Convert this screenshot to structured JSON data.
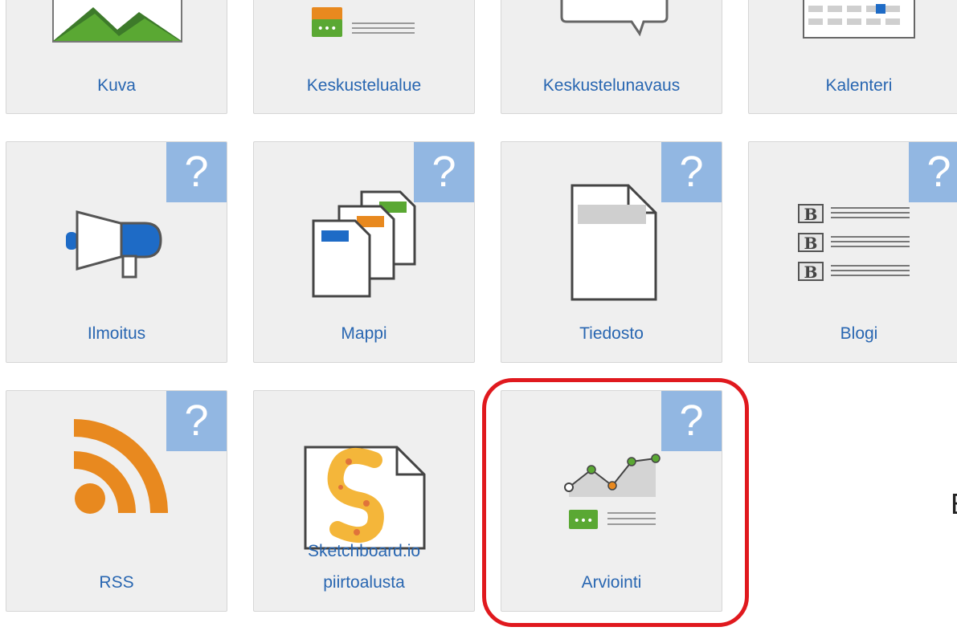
{
  "tiles": [
    {
      "id": "kuva",
      "label": "Kuva",
      "icon": "image-icon"
    },
    {
      "id": "keskustelualue",
      "label": "Keskustelualue",
      "icon": "forum-icon"
    },
    {
      "id": "keskustelunavaus",
      "label": "Keskustelunavaus",
      "icon": "speech-bubble-icon"
    },
    {
      "id": "kalenteri",
      "label": "Kalenteri",
      "icon": "calendar-icon"
    },
    {
      "id": "ilmoitus",
      "label": "Ilmoitus",
      "icon": "megaphone-icon"
    },
    {
      "id": "mappi",
      "label": "Mappi",
      "icon": "folder-pages-icon"
    },
    {
      "id": "tiedosto",
      "label": "Tiedosto",
      "icon": "file-icon"
    },
    {
      "id": "blogi",
      "label": "Blogi",
      "icon": "blog-icon"
    },
    {
      "id": "rss",
      "label": "RSS",
      "icon": "rss-icon"
    },
    {
      "id": "sketchboard",
      "label_line1": "Sketchboard.io",
      "label_line2": "piirtoalusta",
      "icon": "sketchboard-icon"
    },
    {
      "id": "arviointi",
      "label": "Arviointi",
      "icon": "rating-chart-icon"
    }
  ],
  "help_symbol": "?",
  "edge_text": "E",
  "colors": {
    "tile_bg": "#efefef",
    "label": "#2866b1",
    "help_bg": "#92b7e2",
    "highlight": "#e0191e",
    "accent_green": "#5aa833",
    "accent_orange": "#e8891f",
    "accent_blue": "#1e6bc6"
  }
}
